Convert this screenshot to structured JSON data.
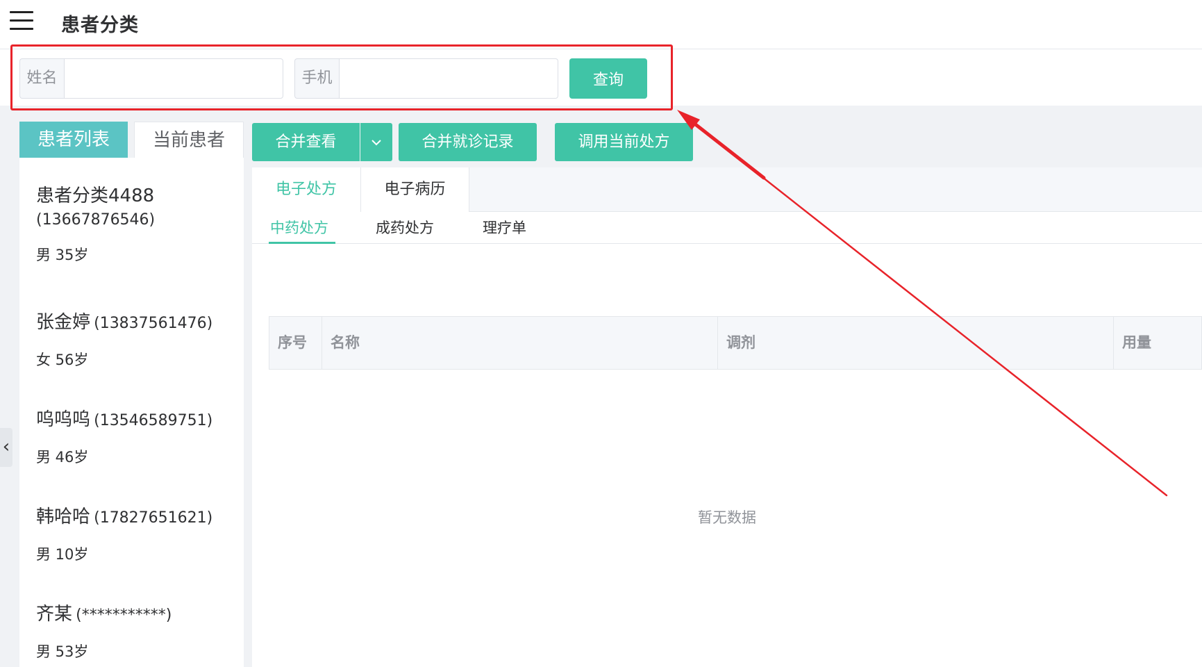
{
  "header": {
    "title": "患者分类"
  },
  "search": {
    "name_label": "姓名",
    "name_value": "",
    "phone_label": "手机",
    "phone_value": "",
    "query_label": "查询"
  },
  "patient_tabs": {
    "list_label": "患者列表",
    "current_label": "当前患者"
  },
  "patients": [
    {
      "name": "患者分类4488",
      "phone": "(13667876546)",
      "info": "男 35岁"
    },
    {
      "name": "张金婷",
      "phone": "(13837561476)",
      "info": "女 56岁"
    },
    {
      "name": "呜呜呜",
      "phone": "(13546589751)",
      "info": "男 46岁"
    },
    {
      "name": "韩哈哈",
      "phone": "(17827651621)",
      "info": "男 10岁"
    },
    {
      "name": "齐某",
      "phone": "(***********)",
      "info": "男 53岁"
    }
  ],
  "toolbar": {
    "merge_view": "合并查看",
    "merge_records": "合并就诊记录",
    "apply_prescription": "调用当前处方"
  },
  "record_tabs": {
    "prescription": "电子处方",
    "medical_record": "电子病历"
  },
  "prescription_tabs": {
    "herbal": "中药处方",
    "patent": "成药处方",
    "therapy": "理疗单"
  },
  "table": {
    "columns": [
      "序号",
      "名称",
      "调剂",
      "用量"
    ],
    "empty_text": "暂无数据"
  },
  "colors": {
    "accent": "#40c4a6",
    "tab_active": "#5bc4c4",
    "annotation": "#e8232a"
  },
  "icons": {
    "menu": "hamburger-menu-icon",
    "dropdown": "chevron-down-icon",
    "collapse": "chevron-left-icon"
  }
}
